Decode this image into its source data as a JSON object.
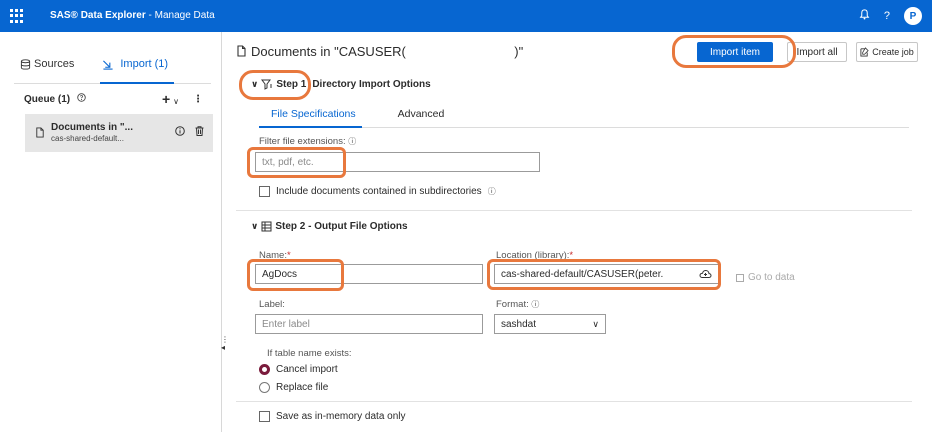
{
  "topbar": {
    "app_title_brand": "SAS® Data Explorer",
    "app_title_sep": " - ",
    "app_title_page": "Manage Data",
    "bell_icon": "bell-icon",
    "help_label": "?",
    "avatar_letter": "P"
  },
  "left_panel": {
    "tabs": [
      {
        "label": "Sources",
        "icon": "database-icon"
      },
      {
        "label": "Import (1)",
        "icon": "import-icon"
      }
    ],
    "queue_label": "Queue (1)",
    "queue_card": {
      "title": "Documents in \"...",
      "subtitle": "cas-shared-default..."
    }
  },
  "main": {
    "title_prefix": "Documents in \"CASUSER(",
    "title_suffix": ")\"",
    "buttons": {
      "import_item": "Import item",
      "import_all": "Import all",
      "create_job": "Create job"
    },
    "step1": {
      "label": "Step 1",
      "title": "Directory Import Options",
      "tabs": [
        "File Specifications",
        "Advanced"
      ],
      "filter_label": "Filter file extensions:",
      "filter_placeholder": "txt, pdf, etc.",
      "include_subdirs_label": "Include documents contained in subdirectories"
    },
    "step2": {
      "title": "Step 2 - Output File Options",
      "name_label": "Name:",
      "name_value": "AgDocs",
      "location_label": "Location (library):",
      "location_value": "cas-shared-default/CASUSER(peter.",
      "go_to_data": "Go to data",
      "label_label": "Label:",
      "label_placeholder": "Enter label",
      "format_label": "Format:",
      "format_value": "sashdat",
      "if_exists_label": "If table name exists:",
      "options": [
        "Cancel import",
        "Replace file"
      ],
      "selected_option": "Cancel import",
      "in_memory_label": "Save as in-memory data only"
    }
  },
  "colors": {
    "brand_blue": "#0766d1",
    "highlight_orange": "#e8783d",
    "radio_selected": "#7a1b3c"
  }
}
